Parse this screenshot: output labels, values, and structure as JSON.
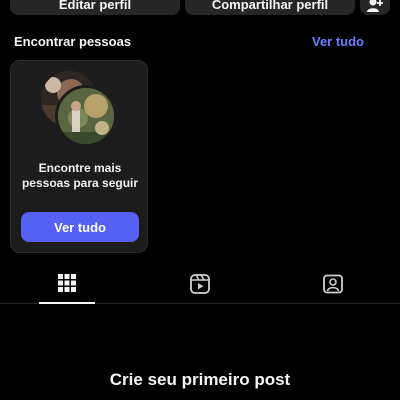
{
  "profile_actions": {
    "edit_label": "Editar perfil",
    "share_label": "Compartilhar perfil"
  },
  "suggestions": {
    "title": "Encontrar pessoas",
    "see_all": "Ver tudo",
    "card": {
      "text": "Encontre mais pessoas para seguir",
      "button_label": "Ver tudo"
    }
  },
  "tabs": [
    {
      "name": "posts",
      "icon": "grid-icon",
      "active": true
    },
    {
      "name": "reels",
      "icon": "reels-icon",
      "active": false
    },
    {
      "name": "tagged",
      "icon": "tagged-user-icon",
      "active": false
    }
  ],
  "empty_state": {
    "title": "Crie seu primeiro post"
  },
  "colors": {
    "background": "#000000",
    "accent_link": "#6b7cff",
    "primary_button": "#5560f5",
    "secondary_button": "#262626"
  }
}
